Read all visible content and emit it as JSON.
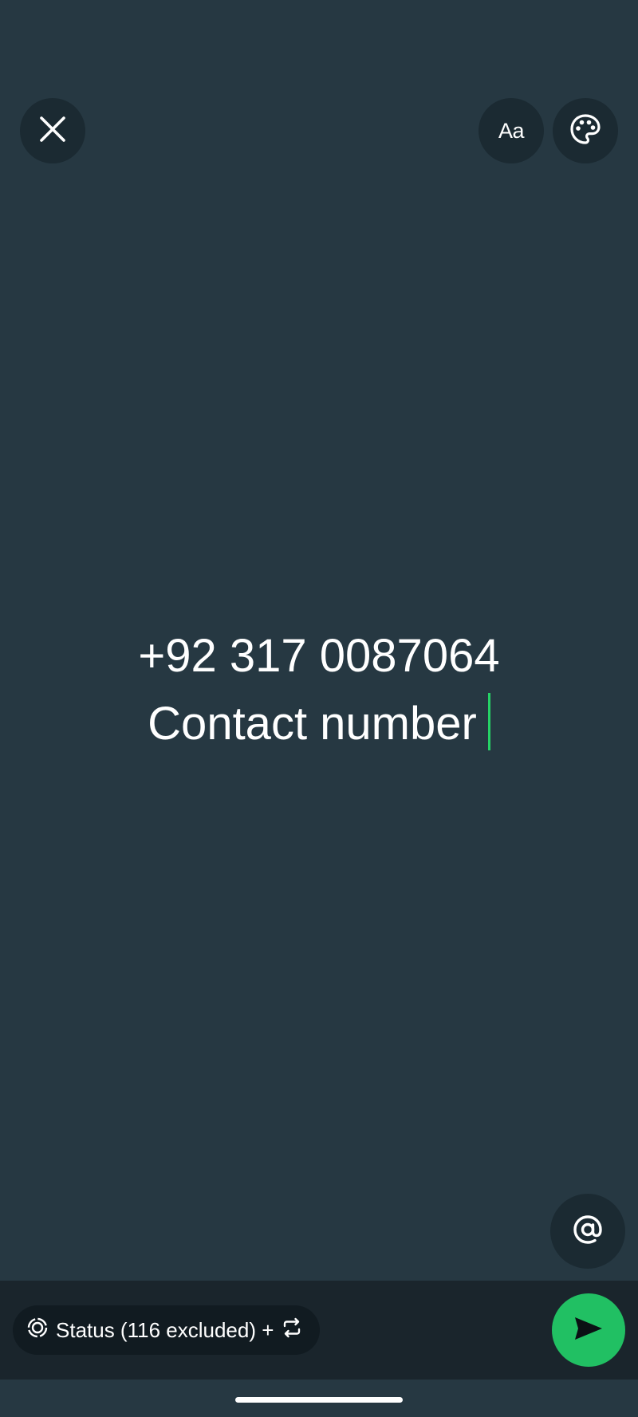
{
  "toolbar": {
    "close_icon": "close-icon",
    "font_label": "Aa",
    "palette_icon": "palette-icon"
  },
  "status_text": {
    "line1": "+92 317 0087064",
    "line2": "Contact number",
    "caret_color": "#25d366"
  },
  "mention": {
    "icon": "at-sign-icon"
  },
  "audience": {
    "icon": "status-ring-icon",
    "label": "Status (116 excluded) +",
    "switch_icon": "repeat-icon"
  },
  "send": {
    "icon": "send-icon",
    "color": "#21c063"
  },
  "colors": {
    "background": "#263842",
    "button_bg": "#1b2a32",
    "bottom_bar": "#1a252c",
    "pill_bg": "#111b21"
  }
}
